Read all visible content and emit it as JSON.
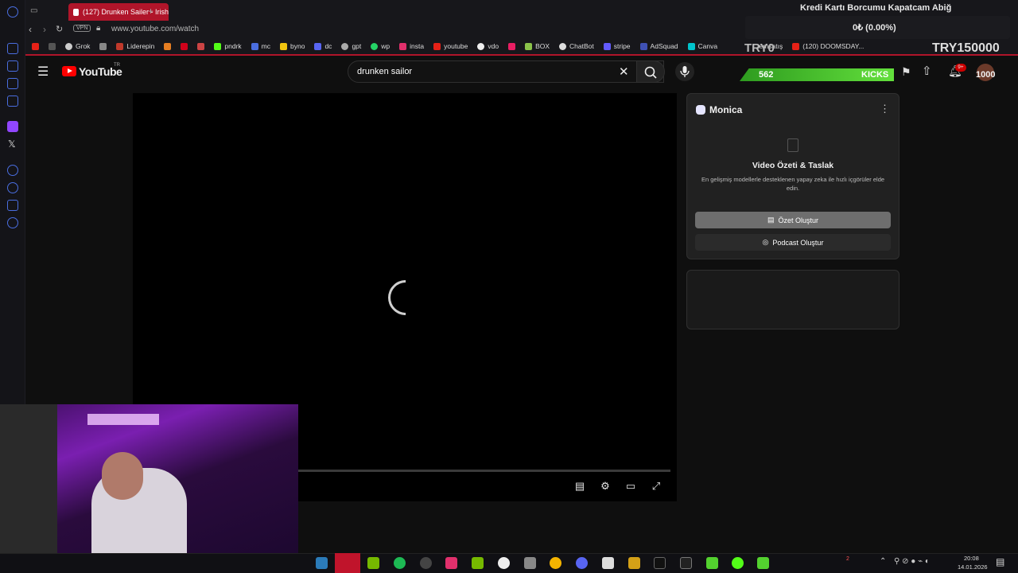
{
  "browser": {
    "tab_title": "(127) Drunken Sailer - Irish",
    "url": "www.youtube.com/watch",
    "vpn_label": "VPN",
    "bookmarks": [
      "Grok",
      "Liderepin",
      "pndrk",
      "mc",
      "byno",
      "dc",
      "gpt",
      "wp",
      "insta",
      "youtube",
      "vdo",
      "BOX",
      "ChatBot",
      "stripe",
      "AdSquad",
      "Canva",
      "temsatış",
      "(120) DOOMSDAY..."
    ]
  },
  "youtube": {
    "logo": "YouTube",
    "region": "TR",
    "search_value": "drunken sailor",
    "notif_badge": "9+"
  },
  "monica": {
    "title": "Monica",
    "heading": "Video Özeti & Taslak",
    "description": "En gelişmiş modellerle desteklenen yapay zeka ile hızlı içgörüler elde edin.",
    "btn_summary": "Özet Oluştur",
    "btn_podcast": "Podcast Oluştur"
  },
  "stream_overlay": {
    "donation_text": "Kredi Kartı Borcumu Kapatcam Abiğ",
    "progress_text": "0₺ (0.00%)",
    "goal_left": "TRY0",
    "goal_right": "TRY150000",
    "kicks_count": "562",
    "kicks_label": "KICKS",
    "counter": "1000"
  },
  "taskbar": {
    "time": "20:08",
    "date": "14.01.2026",
    "badge": "2"
  },
  "colors": {
    "accent_red": "#b0152a",
    "kicks_green": "#53d12f",
    "bg": "#0f0f0f"
  }
}
